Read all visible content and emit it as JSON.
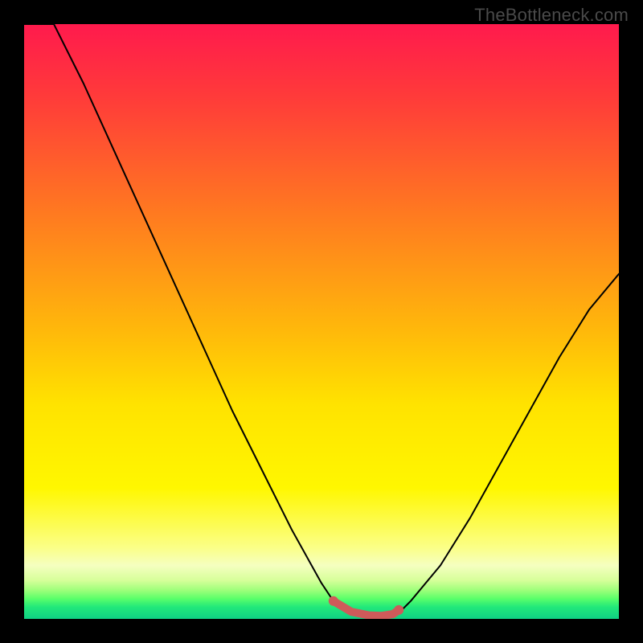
{
  "watermark": "TheBottleneck.com",
  "chart_data": {
    "type": "line",
    "title": "",
    "xlabel": "",
    "ylabel": "",
    "xlim": [
      0,
      100
    ],
    "ylim": [
      0,
      100
    ],
    "grid": false,
    "legend": false,
    "background_gradient": {
      "description": "vertical gradient, top = severe bottleneck, bottom = no bottleneck",
      "stops": [
        {
          "pos": 0.0,
          "color": "#ff1a4d",
          "meaning": "worst"
        },
        {
          "pos": 0.5,
          "color": "#ffba0a",
          "meaning": "moderate"
        },
        {
          "pos": 0.8,
          "color": "#fff700",
          "meaning": "mild"
        },
        {
          "pos": 1.0,
          "color": "#0fd084",
          "meaning": "best"
        }
      ]
    },
    "series": [
      {
        "name": "bottleneck-curve",
        "color": "#000000",
        "x": [
          0,
          5,
          10,
          15,
          20,
          25,
          30,
          35,
          40,
          45,
          50,
          52,
          55,
          60,
          63,
          65,
          70,
          75,
          80,
          85,
          90,
          95,
          100
        ],
        "y_value": [
          110,
          100,
          90,
          79,
          68,
          57,
          46,
          35,
          25,
          15,
          6,
          3,
          1,
          0,
          1,
          3,
          9,
          17,
          26,
          35,
          44,
          52,
          58
        ],
        "note": "y_value interpreted as bottleneck percentage; 0 at the dip ≈ no bottleneck; values >100 clip off the top edge"
      },
      {
        "name": "optimal-range-marker",
        "color": "#d15a5a",
        "style": "thick-rounded",
        "x": [
          52,
          55,
          58,
          60,
          62,
          63
        ],
        "y_value": [
          3,
          1.2,
          0.6,
          0.5,
          0.8,
          1.5
        ],
        "note": "short pink/coral segment hugging the bottom of the dip indicating the balanced region"
      }
    ]
  }
}
